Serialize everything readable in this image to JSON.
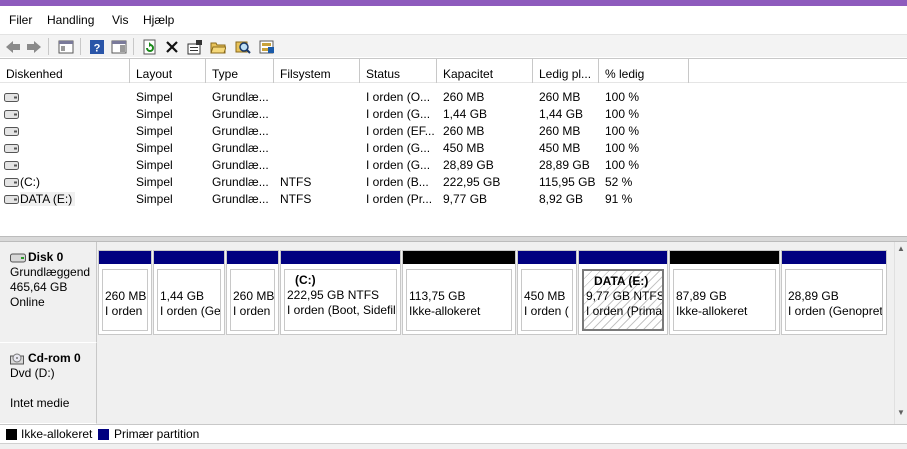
{
  "menu": [
    "Filer",
    "Handling",
    "Vis",
    "Hjælp"
  ],
  "toolbar_icons": [
    "back-arrow-icon",
    "forward-arrow-icon",
    "console-tree-icon",
    "help-icon",
    "properties-pane-icon",
    "refresh-icon",
    "delete-icon",
    "properties-icon",
    "open-folder-icon",
    "search-disk-icon",
    "rescan-disks-icon"
  ],
  "columns": [
    "Diskenhed",
    "Layout",
    "Type",
    "Filsystem",
    "Status",
    "Kapacitet",
    "Ledig pl...",
    "% ledig"
  ],
  "rows": [
    [
      "",
      "Simpel",
      "Grundlæ...",
      "",
      "I orden (O...",
      "260 MB",
      "260 MB",
      "100 %"
    ],
    [
      "",
      "Simpel",
      "Grundlæ...",
      "",
      "I orden (G...",
      "1,44 GB",
      "1,44 GB",
      "100 %"
    ],
    [
      "",
      "Simpel",
      "Grundlæ...",
      "",
      "I orden (EF...",
      "260 MB",
      "260 MB",
      "100 %"
    ],
    [
      "",
      "Simpel",
      "Grundlæ...",
      "",
      "I orden (G...",
      "450 MB",
      "450 MB",
      "100 %"
    ],
    [
      "",
      "Simpel",
      "Grundlæ...",
      "",
      "I orden (G...",
      "28,89 GB",
      "28,89 GB",
      "100 %"
    ],
    [
      "(C:)",
      "Simpel",
      "Grundlæ...",
      "NTFS",
      "I orden (B...",
      "222,95 GB",
      "115,95 GB",
      "52 %"
    ],
    [
      "DATA (E:)",
      "Simpel",
      "Grundlæ...",
      "NTFS",
      "I orden (Pr...",
      "9,77 GB",
      "8,92 GB",
      "91 %"
    ]
  ],
  "disk0": {
    "name": "Disk 0",
    "type": "Grundlæggend",
    "size": "465,64 GB",
    "state": "Online",
    "partitions": [
      {
        "title": "",
        "line1": "260 MB",
        "line2": "I orden",
        "kind": "primary"
      },
      {
        "title": "",
        "line1": "1,44 GB",
        "line2": "I orden (Ge",
        "kind": "primary"
      },
      {
        "title": "",
        "line1": "260 MB",
        "line2": "I orden",
        "kind": "primary"
      },
      {
        "title": "(C:)",
        "line1": "222,95 GB NTFS",
        "line2": "I orden (Boot, Sidefil",
        "kind": "primary"
      },
      {
        "title": "",
        "line1": "113,75 GB",
        "line2": "Ikke-allokeret",
        "kind": "unallocated"
      },
      {
        "title": "",
        "line1": "450 MB",
        "line2": "I orden (",
        "kind": "primary"
      },
      {
        "title": "DATA  (E:)",
        "line1": "9,77 GB NTFS",
        "line2": "I orden (Prima",
        "kind": "primary",
        "selected": true
      },
      {
        "title": "",
        "line1": "87,89 GB",
        "line2": "Ikke-allokeret",
        "kind": "unallocated"
      },
      {
        "title": "",
        "line1": "28,89 GB",
        "line2": "I orden (Genopret",
        "kind": "primary"
      }
    ]
  },
  "cdrom0": {
    "name": "Cd-rom 0",
    "drive": "Dvd (D:)",
    "media": "Intet medie"
  },
  "legend": [
    {
      "label": "Ikke-allokeret",
      "color": "#000000"
    },
    {
      "label": "Primær partition",
      "color": "#000080"
    }
  ],
  "colors": {
    "primary": "#000080",
    "unallocated": "#000000",
    "title_bar": "#8e5bbd"
  }
}
